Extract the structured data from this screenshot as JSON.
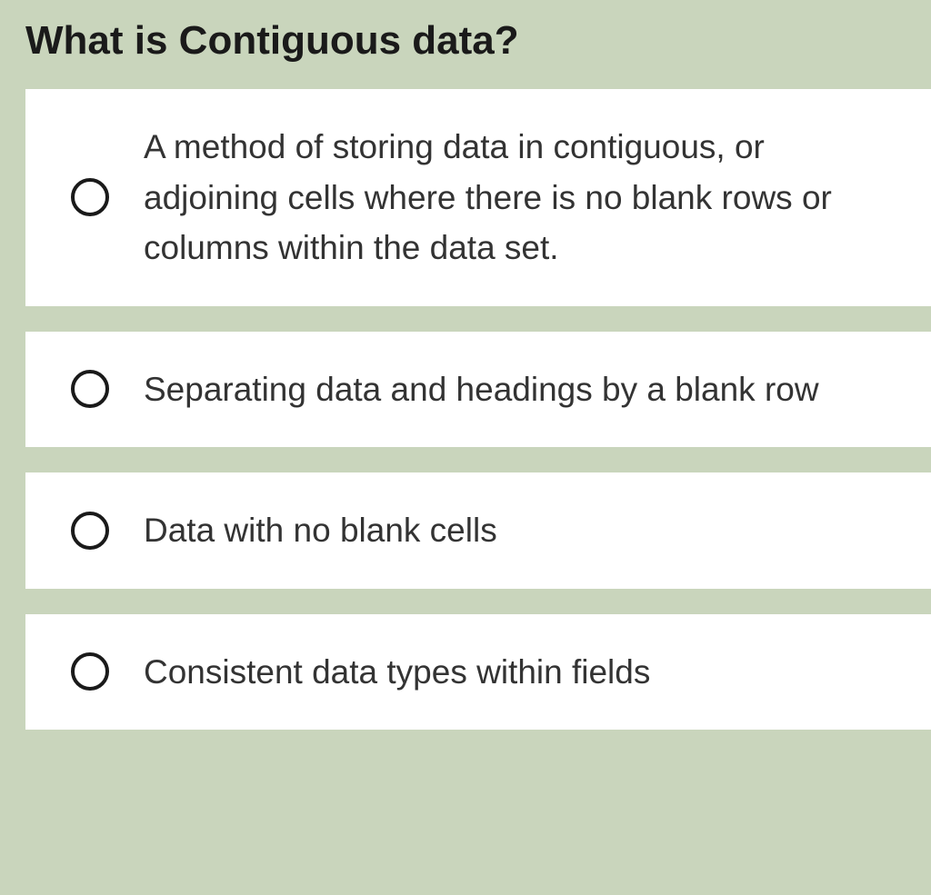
{
  "question": {
    "title": "What is Contiguous data?"
  },
  "options": [
    {
      "text": "A method of storing data in contiguous, or adjoining cells where there is no blank rows or columns within the data set."
    },
    {
      "text": "Separating data and headings by a blank row"
    },
    {
      "text": "Data with no blank cells"
    },
    {
      "text": "Consistent data types within fields"
    }
  ]
}
